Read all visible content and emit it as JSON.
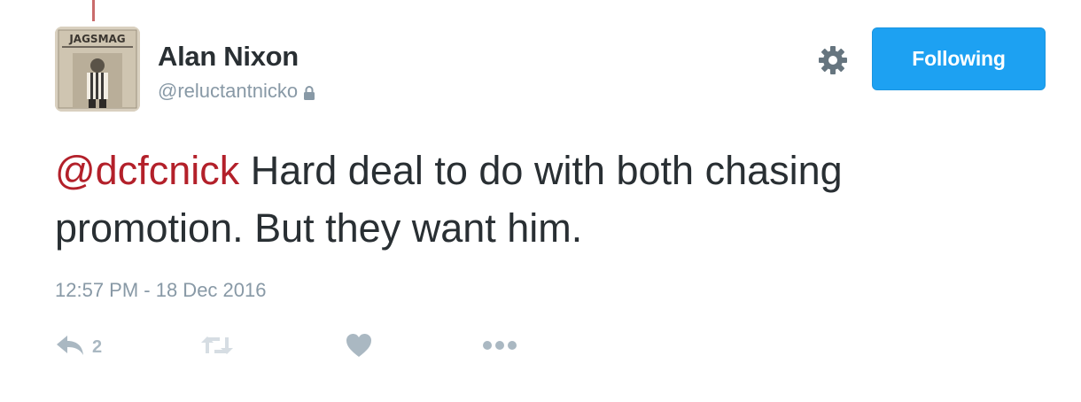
{
  "user": {
    "name": "Alan Nixon",
    "handle": "@reluctantnicko",
    "avatar_text": "JAGSMAG",
    "protected": true
  },
  "follow_button": {
    "label": "Following"
  },
  "tweet": {
    "mention": "@dcfcnick",
    "text": " Hard deal to do with both chasing promotion. But they want him.",
    "timestamp": "12:57 PM - 18 Dec 2016"
  },
  "actions": {
    "reply_count": "2"
  },
  "colors": {
    "accent": "#1da1f2",
    "mention": "#b3202a",
    "muted": "#8899a6",
    "action_icon": "#aab8c2"
  },
  "icons": {
    "settings": "gear-icon",
    "lock": "lock-icon",
    "reply": "reply-icon",
    "retweet": "retweet-icon",
    "like": "heart-icon",
    "more": "more-icon"
  }
}
